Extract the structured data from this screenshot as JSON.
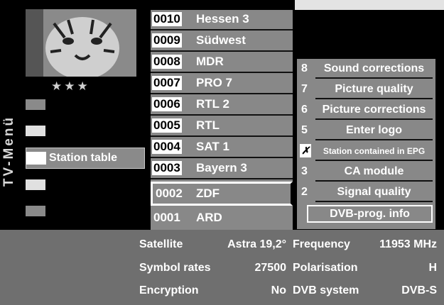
{
  "menu": {
    "vertical_title": "TV-Menü",
    "rating_stars": "★★★",
    "station_table_label": "Station table"
  },
  "programs": [
    {
      "number": "0010",
      "name": "Hessen 3"
    },
    {
      "number": "0009",
      "name": "Südwest"
    },
    {
      "number": "0008",
      "name": "MDR"
    },
    {
      "number": "0007",
      "name": "PRO 7"
    },
    {
      "number": "0006",
      "name": "RTL 2"
    },
    {
      "number": "0005",
      "name": "RTL"
    },
    {
      "number": "0004",
      "name": "SAT 1"
    },
    {
      "number": "0003",
      "name": "Bayern 3"
    },
    {
      "number": "0002",
      "name": "ZDF"
    },
    {
      "number": "0001",
      "name": "ARD"
    }
  ],
  "options": [
    {
      "key": "8",
      "label": "Sound corrections"
    },
    {
      "key": "7",
      "label": "Picture quality"
    },
    {
      "key": "6",
      "label": "Picture corrections"
    },
    {
      "key": "5",
      "label": "Enter logo"
    },
    {
      "key": "✗",
      "label": "Station contained in EPG"
    },
    {
      "key": "3",
      "label": "CA module"
    },
    {
      "key": "2",
      "label": "Signal quality"
    },
    {
      "key": "",
      "label": "DVB-prog. info"
    }
  ],
  "info": {
    "satellite_label": "Satellite",
    "satellite_value": "Astra 19,2°",
    "symbol_rates_label": "Symbol rates",
    "symbol_rates_value": "27500",
    "encryption_label": "Encryption",
    "encryption_value": "No",
    "frequency_label": "Frequency",
    "frequency_value": "11953 MHz",
    "polarisation_label": "Polarisation",
    "polarisation_value": "H",
    "dvb_system_label": "DVB system",
    "dvb_system_value": "DVB-S"
  }
}
